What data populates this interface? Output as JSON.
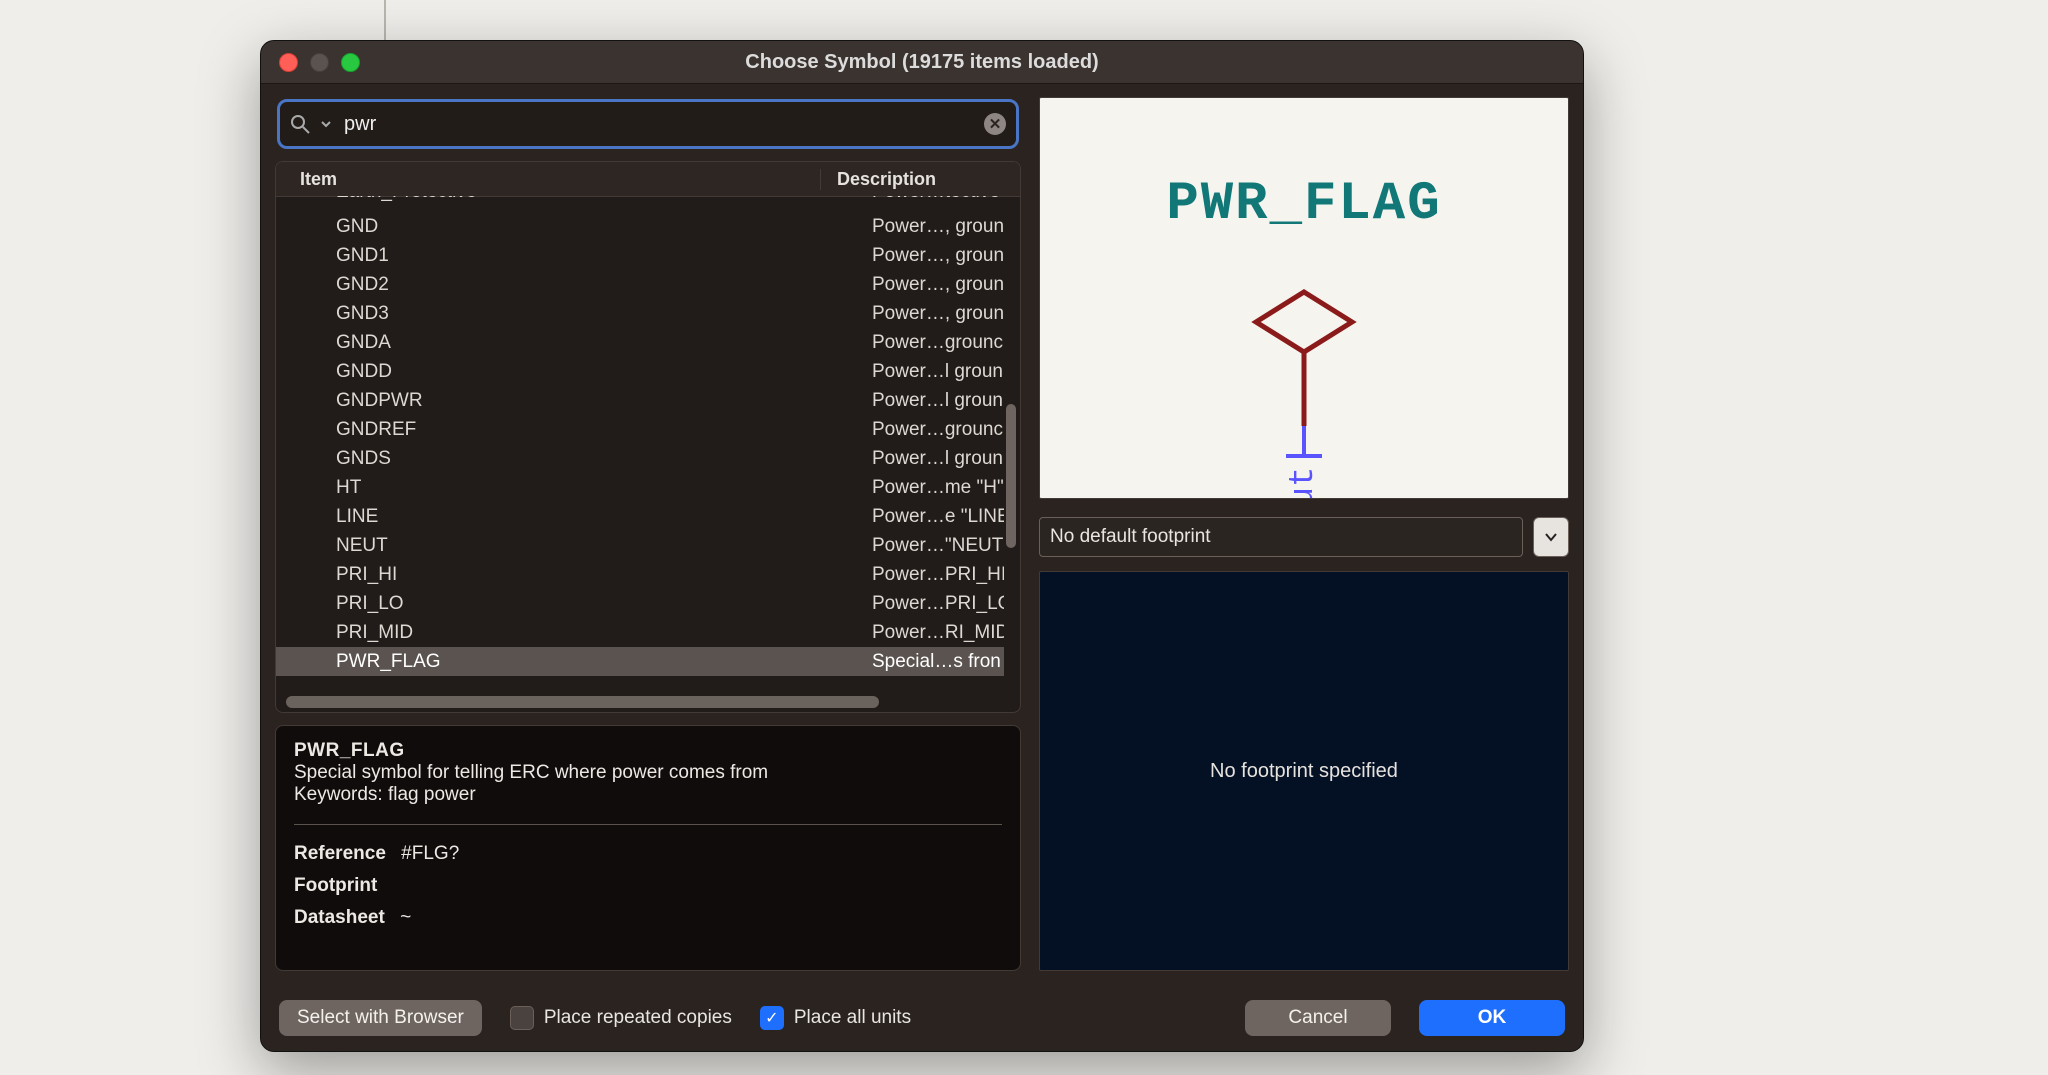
{
  "window": {
    "title": "Choose Symbol (19175 items loaded)"
  },
  "search": {
    "value": "pwr",
    "placeholder": ""
  },
  "columns": {
    "item": "Item",
    "description": "Description"
  },
  "rows": [
    {
      "item": "Earth_Protective",
      "desc": "Power…tective",
      "cutoffTop": true
    },
    {
      "item": "GND",
      "desc": "Power…, groun"
    },
    {
      "item": "GND1",
      "desc": "Power…, groun"
    },
    {
      "item": "GND2",
      "desc": "Power…, groun"
    },
    {
      "item": "GND3",
      "desc": "Power…, groun"
    },
    {
      "item": "GNDA",
      "desc": "Power…grounc"
    },
    {
      "item": "GNDD",
      "desc": "Power…l groun"
    },
    {
      "item": "GNDPWR",
      "desc": "Power…l groun"
    },
    {
      "item": "GNDREF",
      "desc": "Power…grounc"
    },
    {
      "item": "GNDS",
      "desc": "Power…l groun"
    },
    {
      "item": "HT",
      "desc": "Power…me \"H\""
    },
    {
      "item": "LINE",
      "desc": "Power…e \"LINE"
    },
    {
      "item": "NEUT",
      "desc": "Power…\"NEUT"
    },
    {
      "item": "PRI_HI",
      "desc": "Power…PRI_HI"
    },
    {
      "item": "PRI_LO",
      "desc": "Power…PRI_LO"
    },
    {
      "item": "PRI_MID",
      "desc": "Power…RI_MID"
    },
    {
      "item": "PWR_FLAG",
      "desc": "Special…s fron",
      "selected": true
    }
  ],
  "details": {
    "title": "PWR_FLAG",
    "line1": "Special symbol for telling ERC where power comes from",
    "line2": "Keywords: flag power",
    "ref_label": "Reference",
    "ref_value": "#FLG?",
    "fp_label": "Footprint",
    "fp_value": "",
    "ds_label": "Datasheet",
    "ds_value": "~"
  },
  "preview_label": "PWR_FLAG",
  "preview_pin_text": "ut",
  "footprint_select": "No default footprint",
  "footprint_preview_msg": "No footprint specified",
  "buttons": {
    "select_browser": "Select with Browser",
    "repeated": "Place repeated copies",
    "all_units": "Place all units",
    "cancel": "Cancel",
    "ok": "OK"
  },
  "checks": {
    "repeated": false,
    "all_units": true
  }
}
